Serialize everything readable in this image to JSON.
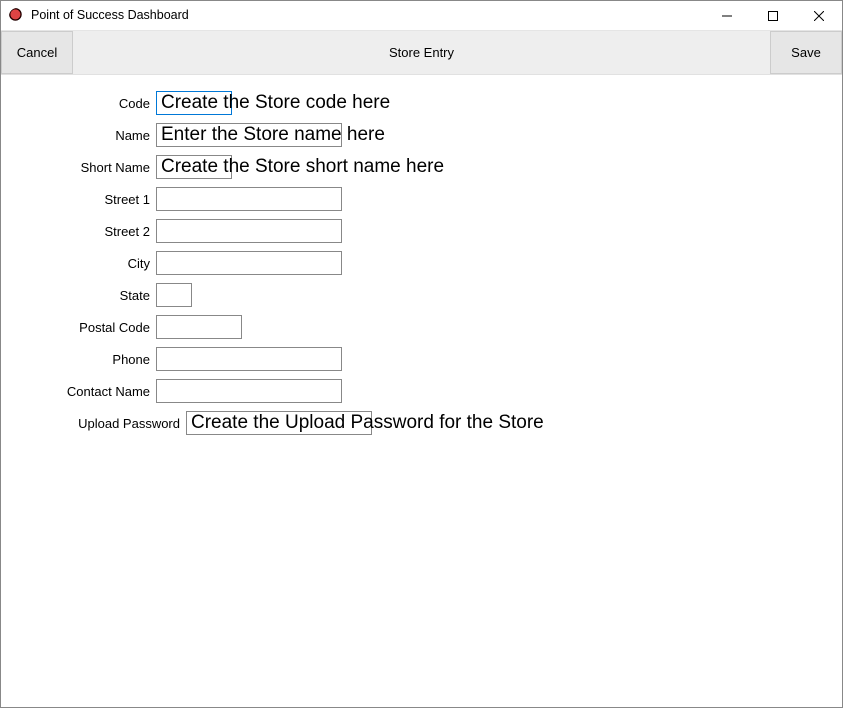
{
  "window": {
    "title": "Point of Success Dashboard"
  },
  "toolbar": {
    "cancel_label": "Cancel",
    "title": "Store Entry",
    "save_label": "Save"
  },
  "labels": {
    "code": "Code",
    "name": "Name",
    "short_name": "Short Name",
    "street1": "Street 1",
    "street2": "Street 2",
    "city": "City",
    "state": "State",
    "postal": "Postal Code",
    "phone": "Phone",
    "contact": "Contact Name",
    "upload_pw": "Upload Password"
  },
  "hints": {
    "code": "Create the Store code here",
    "name": "Enter the Store name here",
    "short_name": "Create the Store short name here",
    "upload_pw": "Create the Upload Password for the Store"
  },
  "values": {
    "code": "",
    "name": "",
    "short_name": "",
    "street1": "",
    "street2": "",
    "city": "",
    "state": "",
    "postal": "",
    "phone": "",
    "contact": "",
    "upload_pw": ""
  }
}
